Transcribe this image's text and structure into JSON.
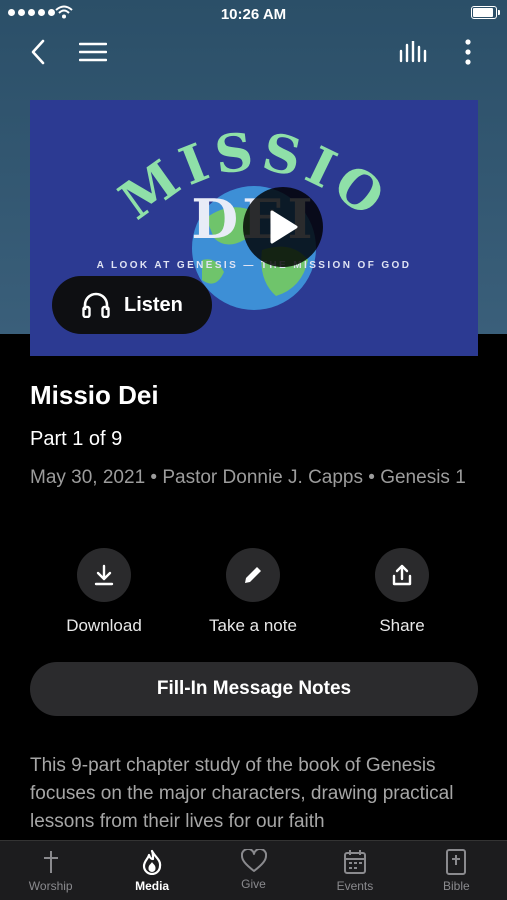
{
  "status": {
    "time": "10:26 AM"
  },
  "nav": {
    "back_icon": "chevron-left-icon",
    "menu_icon": "hamburger-icon",
    "audio_icon": "audio-bars-icon",
    "more_icon": "more-vertical-icon"
  },
  "hero": {
    "art_title_top": "MISSIO",
    "art_title_bottom": "DEI",
    "art_subtitle": "A LOOK AT GENESIS — THE MISSION OF GOD",
    "listen_label": "Listen",
    "colors": {
      "background": "#2c3a92",
      "lettering": "#8fe0a8",
      "globe_ocean": "#3d8fd6",
      "globe_land": "#6fc46b"
    }
  },
  "sermon": {
    "title": "Missio Dei",
    "part": "Part 1 of 9",
    "meta": "May 30, 2021 • Pastor Donnie J. Capps • Genesis 1"
  },
  "actions": [
    {
      "label": "Download",
      "icon": "download-icon"
    },
    {
      "label": "Take a note",
      "icon": "pencil-icon"
    },
    {
      "label": "Share",
      "icon": "share-icon"
    }
  ],
  "notes_button": "Fill-In Message Notes",
  "description": "This 9-part chapter study of the book of Genesis focuses on the major characters, drawing practical lessons from their lives for our faith",
  "tabs": [
    {
      "label": "Worship",
      "icon": "cross-icon",
      "active": false
    },
    {
      "label": "Media",
      "icon": "flame-icon",
      "active": true
    },
    {
      "label": "Give",
      "icon": "heart-icon",
      "active": false
    },
    {
      "label": "Events",
      "icon": "calendar-icon",
      "active": false
    },
    {
      "label": "Bible",
      "icon": "bible-icon",
      "active": false
    }
  ]
}
